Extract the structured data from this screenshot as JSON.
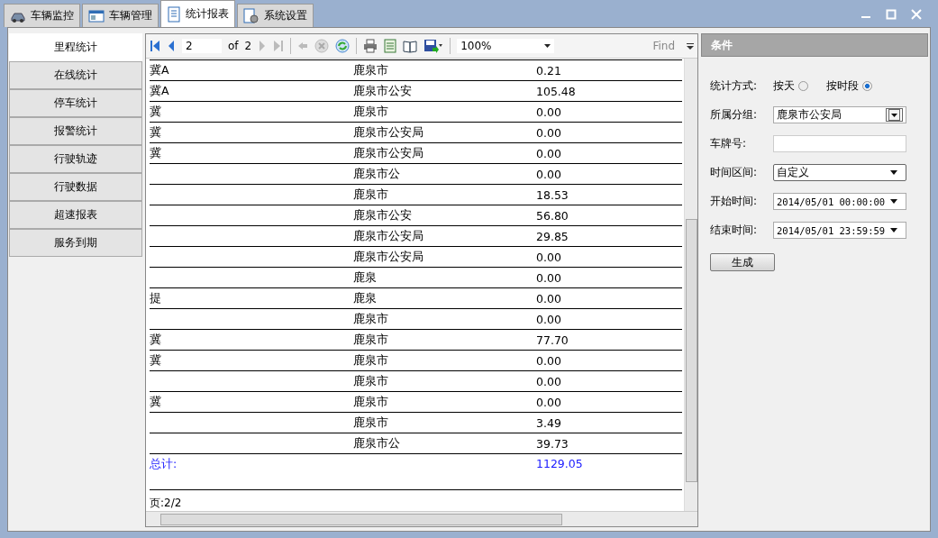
{
  "tabs": [
    {
      "label": "车辆监控",
      "selected": false
    },
    {
      "label": "车辆管理",
      "selected": false
    },
    {
      "label": "统计报表",
      "selected": true
    },
    {
      "label": "系统设置",
      "selected": false
    }
  ],
  "sidebar": {
    "items": [
      {
        "label": "里程统计",
        "selected": true
      },
      {
        "label": "在线统计",
        "selected": false
      },
      {
        "label": "停车统计",
        "selected": false
      },
      {
        "label": "报警统计",
        "selected": false
      },
      {
        "label": "行驶轨迹",
        "selected": false
      },
      {
        "label": "行驶数据",
        "selected": false
      },
      {
        "label": "超速报表",
        "selected": false
      },
      {
        "label": "服务到期",
        "selected": false
      }
    ]
  },
  "report_toolbar": {
    "page": "2",
    "of_label": "of",
    "page_count": "2",
    "zoom": "100%",
    "find": "Find"
  },
  "table": {
    "rows": [
      {
        "column_1": "冀A",
        "column_2": "鹿泉市",
        "column_3": "0.21"
      },
      {
        "column_1": "冀A",
        "column_2": "鹿泉市公安",
        "column_3": "105.48"
      },
      {
        "column_1": "冀",
        "column_2": "鹿泉市",
        "column_3": "0.00"
      },
      {
        "column_1": "冀",
        "column_2": "鹿泉市公安局",
        "column_3": "0.00"
      },
      {
        "column_1": "冀",
        "column_2": "鹿泉市公安局",
        "column_3": "0.00"
      },
      {
        "column_2": "鹿泉市公",
        "column_3": "0.00"
      },
      {
        "column_2": "鹿泉市",
        "column_3": "18.53"
      },
      {
        "column_2": "鹿泉市公安",
        "column_3": "56.80"
      },
      {
        "column_2": "鹿泉市公安局",
        "column_3": "29.85"
      },
      {
        "column_2": "鹿泉市公安局",
        "column_3": "0.00"
      },
      {
        "column_2": "鹿泉",
        "column_3": "0.00"
      },
      {
        "column_1": "提",
        "column_2": "鹿泉",
        "column_3": "0.00"
      },
      {
        "column_2": "鹿泉市",
        "column_3": "0.00"
      },
      {
        "column_1": "冀",
        "column_2": "鹿泉市",
        "column_3": "77.70"
      },
      {
        "column_1": "冀",
        "column_2": "鹿泉市",
        "column_3": "0.00"
      },
      {
        "column_2": "鹿泉市",
        "column_3": "0.00"
      },
      {
        "column_1": "冀",
        "column_2": "鹿泉市",
        "column_3": "0.00"
      },
      {
        "column_2": "鹿泉市",
        "column_3": "3.49"
      },
      {
        "column_2": "鹿泉市公",
        "column_3": "39.73"
      }
    ],
    "total_label": "总计:",
    "total_value": "1129.05"
  },
  "page_footer": "页:2/2",
  "conditions": {
    "title": "条件",
    "mode_label": "统计方式:",
    "modes": [
      {
        "label": "按天",
        "selected": false
      },
      {
        "label": "按时段",
        "selected": true
      }
    ],
    "group_label": "所属分组:",
    "group_value": "鹿泉市公安局",
    "plate_label": "车牌号:",
    "range_label": "时间区间:",
    "range_value": "自定义",
    "start_label": "开始时间:",
    "start_value": "2014/05/01 00:00:00",
    "end_label": "结束时间:",
    "end_value": "2014/05/01 23:59:59",
    "generate": "生成"
  }
}
